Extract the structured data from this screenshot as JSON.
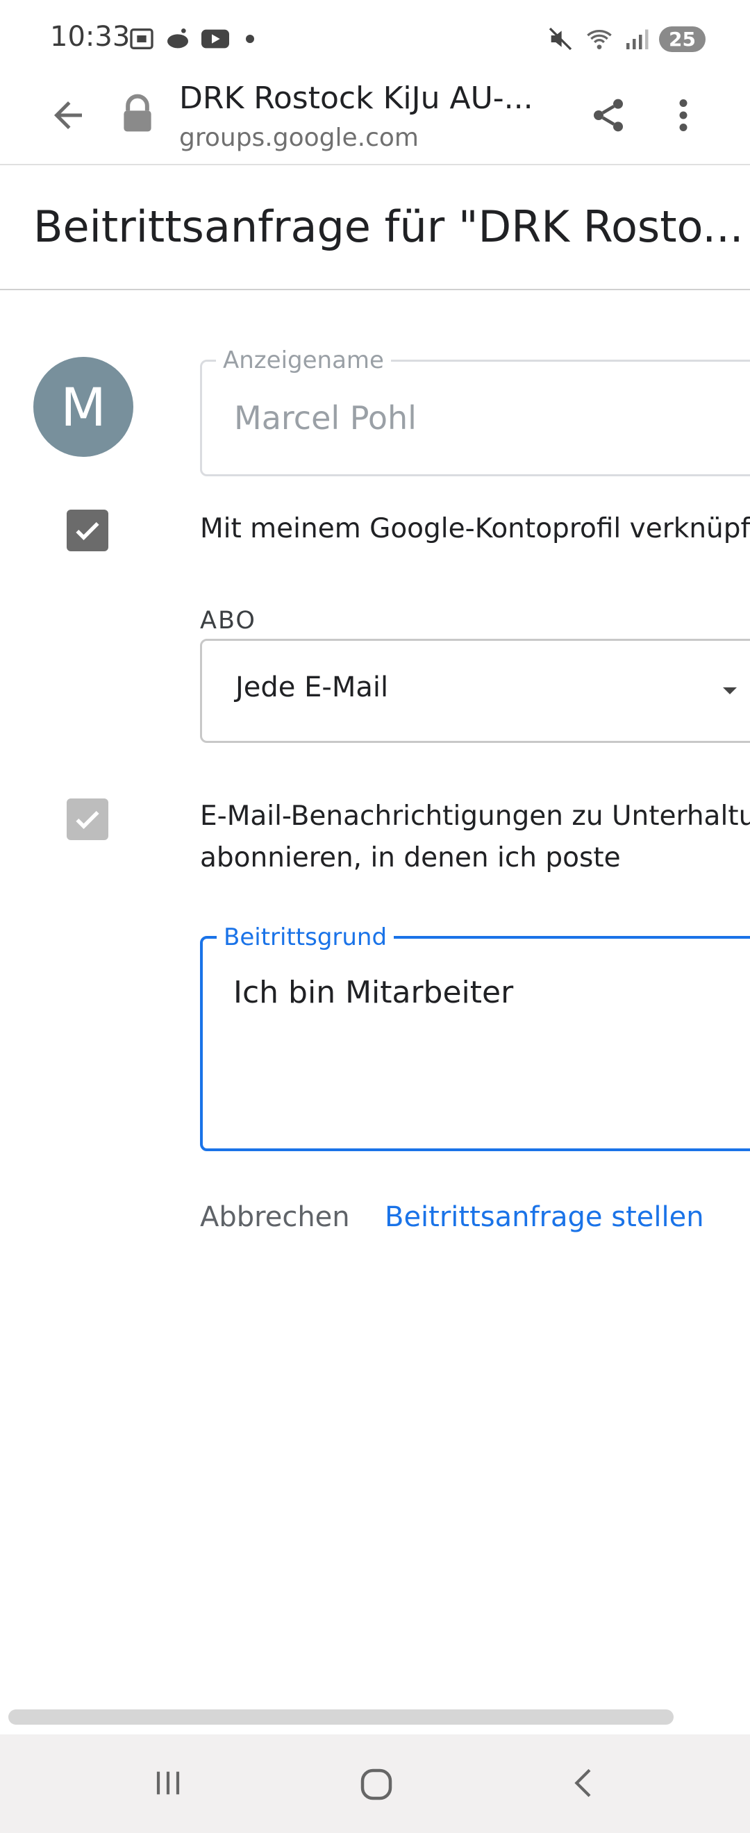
{
  "status_bar": {
    "time": "10:33",
    "battery": "25"
  },
  "browser": {
    "title": "DRK Rostock KiJu AU-...",
    "url": "groups.google.com"
  },
  "page": {
    "title": "Beitrittsanfrage für \"DRK Rosto..."
  },
  "avatar": {
    "initial": "M",
    "color": "#78909c"
  },
  "form": {
    "display_name": {
      "label": "Anzeigename",
      "value": "Marcel Pohl"
    },
    "link_profile": {
      "label": "Mit meinem Google-Kontoprofil verknüpfe",
      "checked": true
    },
    "subscription": {
      "label": "ABO",
      "value": "Jede E-Mail"
    },
    "email_notifications": {
      "line1": "E-Mail-Benachrichtigungen zu Unterhaltun",
      "line2": "abonnieren, in denen ich poste",
      "checked": true
    },
    "reason": {
      "label": "Beitrittsgrund",
      "value": "Ich bin Mitarbeiter"
    },
    "cancel_label": "Abbrechen",
    "submit_label": "Beitrittsanfrage stellen"
  },
  "colors": {
    "accent": "#1a73e8",
    "checkbox_dark": "#6b6b6b",
    "checkbox_light": "#bdbdbd"
  }
}
